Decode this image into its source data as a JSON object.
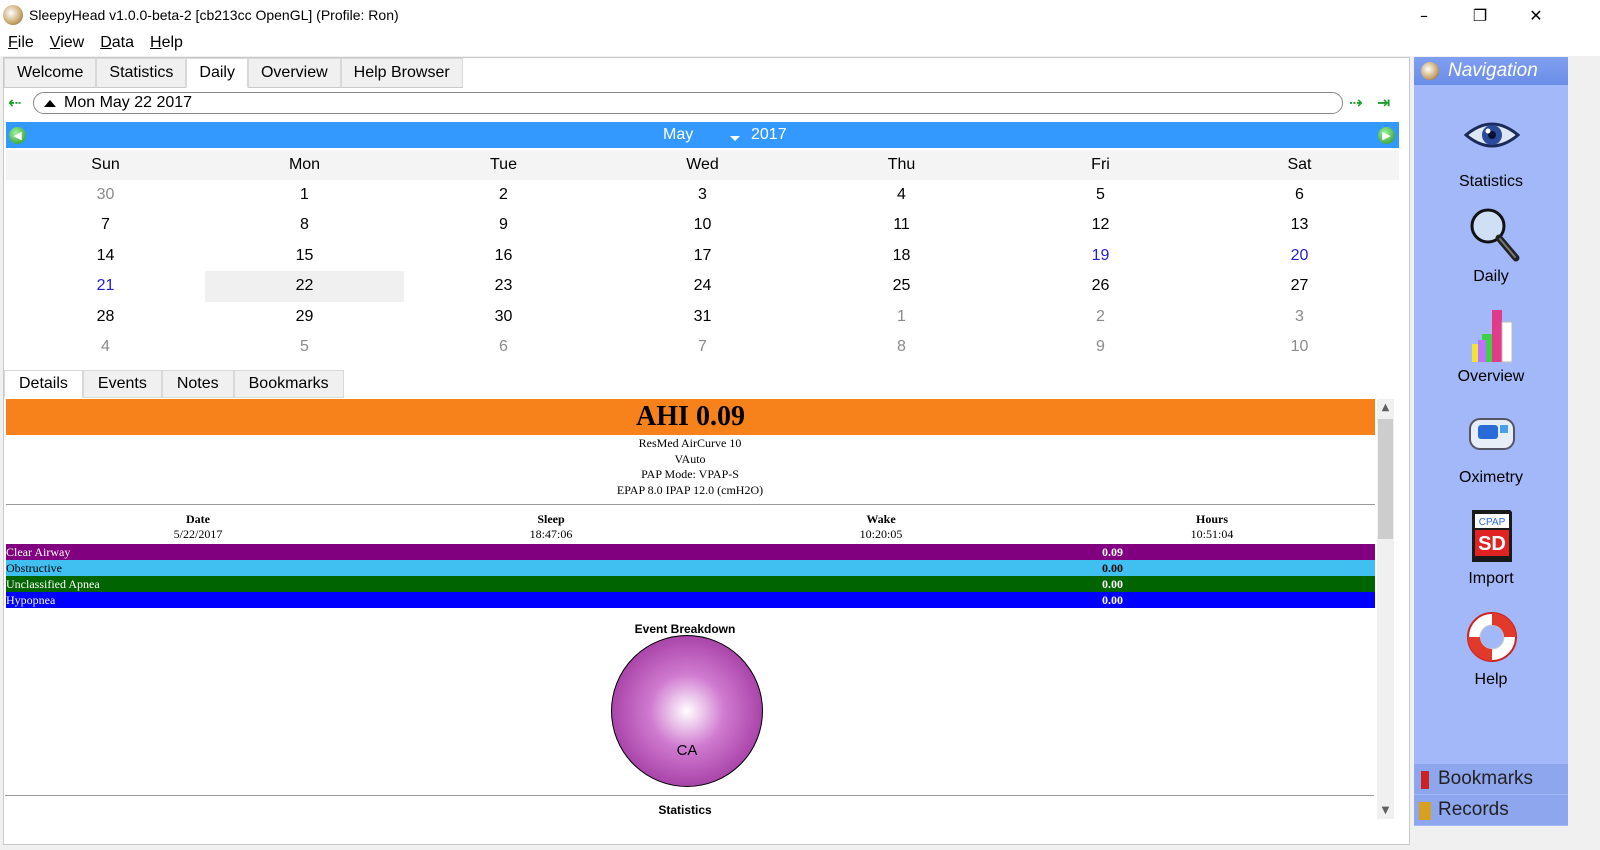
{
  "window": {
    "title": "SleepyHead v1.0.0-beta-2 [cb213cc OpenGL] (Profile: Ron)"
  },
  "menu": [
    "File",
    "View",
    "Data",
    "Help"
  ],
  "tabs": [
    {
      "label": "Welcome"
    },
    {
      "label": "Statistics"
    },
    {
      "label": "Daily"
    },
    {
      "label": "Overview"
    },
    {
      "label": "Help Browser"
    }
  ],
  "date_selector": {
    "value": "Mon May 22 2017"
  },
  "calendar": {
    "month": "May",
    "year": "2017",
    "weekdays": [
      "Sun",
      "Mon",
      "Tue",
      "Wed",
      "Thu",
      "Fri",
      "Sat"
    ],
    "weeks": [
      [
        "30",
        "1",
        "2",
        "3",
        "4",
        "5",
        "6"
      ],
      [
        "7",
        "8",
        "9",
        "10",
        "11",
        "12",
        "13"
      ],
      [
        "14",
        "15",
        "16",
        "17",
        "18",
        "19",
        "20"
      ],
      [
        "21",
        "22",
        "23",
        "24",
        "25",
        "26",
        "27"
      ],
      [
        "28",
        "29",
        "30",
        "31",
        "1",
        "2",
        "3"
      ],
      [
        "4",
        "5",
        "6",
        "7",
        "8",
        "9",
        "10"
      ]
    ],
    "selected": "22"
  },
  "subtabs": [
    {
      "label": "Details"
    },
    {
      "label": "Events"
    },
    {
      "label": "Notes"
    },
    {
      "label": "Bookmarks"
    }
  ],
  "details": {
    "ahi": "AHI 0.09",
    "device": [
      "ResMed AirCurve 10",
      "VAuto",
      "PAP Mode: VPAP-S",
      "EPAP 8.0 IPAP 12.0 (cmH2O)"
    ],
    "summary": [
      {
        "label": "Date",
        "value": "5/22/2017"
      },
      {
        "label": "Sleep",
        "value": "18:47:06"
      },
      {
        "label": "Wake",
        "value": "10:20:05"
      },
      {
        "label": "Hours",
        "value": "10:51:04"
      }
    ],
    "events": [
      {
        "name": "Clear Airway",
        "value": "0.09",
        "color": "#800080"
      },
      {
        "name": "Obstructive",
        "value": "0.00",
        "color": "#40c0f0"
      },
      {
        "name": "Unclassified Apnea",
        "value": "0.00",
        "color": "#006400"
      },
      {
        "name": "Hypopnea",
        "value": "0.00",
        "color": "#0000ff"
      }
    ],
    "breakdown_title": "Event Breakdown",
    "breakdown_label": "CA",
    "statistics_title": "Statistics"
  },
  "navigation": {
    "title": "Navigation",
    "items": [
      {
        "label": "Statistics"
      },
      {
        "label": "Daily"
      },
      {
        "label": "Overview"
      },
      {
        "label": "Oximetry"
      },
      {
        "label": "Import"
      },
      {
        "label": "Help"
      }
    ],
    "import_badge_cpap": "CPAP",
    "import_badge_sd": "SD",
    "bookmarks": "Bookmarks",
    "records": "Records"
  }
}
